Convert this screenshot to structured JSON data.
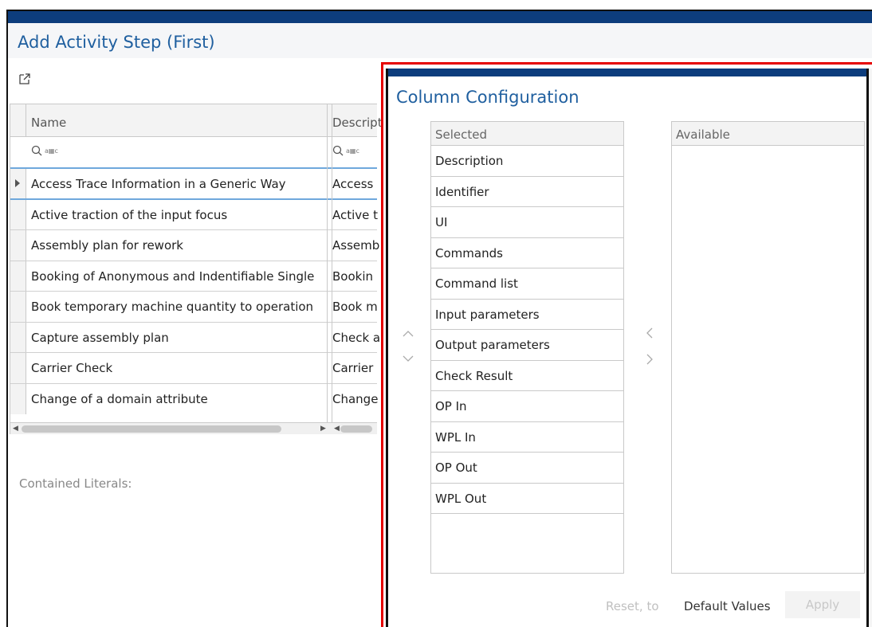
{
  "main": {
    "title": "Add Activity Step (First)",
    "open_icon": "open-in-new-window-icon",
    "columns": {
      "name": "Name",
      "description": "Descript"
    },
    "filter_glyph": "a▦c",
    "rows": [
      {
        "name": "Access Trace Information in a Generic Way",
        "description": "Access"
      },
      {
        "name": "Active traction of the input focus",
        "description": "Active t"
      },
      {
        "name": "Assembly plan for rework",
        "description": "Assemb"
      },
      {
        "name": "Booking of Anonymous and Indentifiable Single",
        "description": "Bookin"
      },
      {
        "name": "Book temporary machine quantity to operation",
        "description": "Book m"
      },
      {
        "name": "Capture assembly plan",
        "description": "Check a"
      },
      {
        "name": "Carrier Check",
        "description": "Carrier"
      },
      {
        "name": "Change of a domain attribute",
        "description": "Change"
      }
    ],
    "contained_literals_label": "Contained Literals:"
  },
  "dialog": {
    "title": "Column Configuration",
    "selected_header": "Selected",
    "available_header": "Available",
    "selected_items": [
      "Description",
      "Identifier",
      "UI",
      "Commands",
      "Command list",
      "Input parameters",
      "Output parameters",
      "Check Result",
      "OP In",
      "WPL In",
      "OP Out",
      "WPL Out"
    ],
    "reset_label": "Reset, to",
    "default_values_label": "Default Values",
    "apply_label": "Apply"
  },
  "colors": {
    "title_bar": "#0d3d7d",
    "title_text": "#1f5f9f",
    "highlight_frame": "#e60000",
    "active_row_border": "#6fa8dc"
  }
}
